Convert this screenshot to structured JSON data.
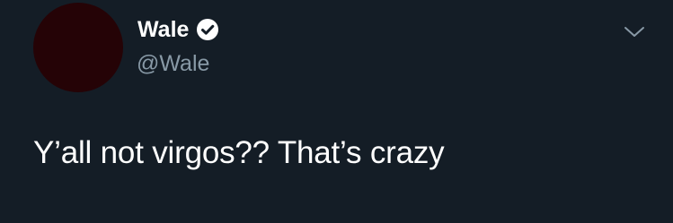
{
  "tweet": {
    "author": {
      "display_name": "Wale",
      "handle": "@Wale",
      "verified": true,
      "verified_icon": "verified-badge-icon",
      "avatar_color": "#250306"
    },
    "menu_icon": "chevron-down-icon",
    "text": "Y’all not virgos?? That’s crazy"
  },
  "colors": {
    "background": "#141d26",
    "primary_text": "#ffffff",
    "secondary_text": "#8899a6"
  }
}
